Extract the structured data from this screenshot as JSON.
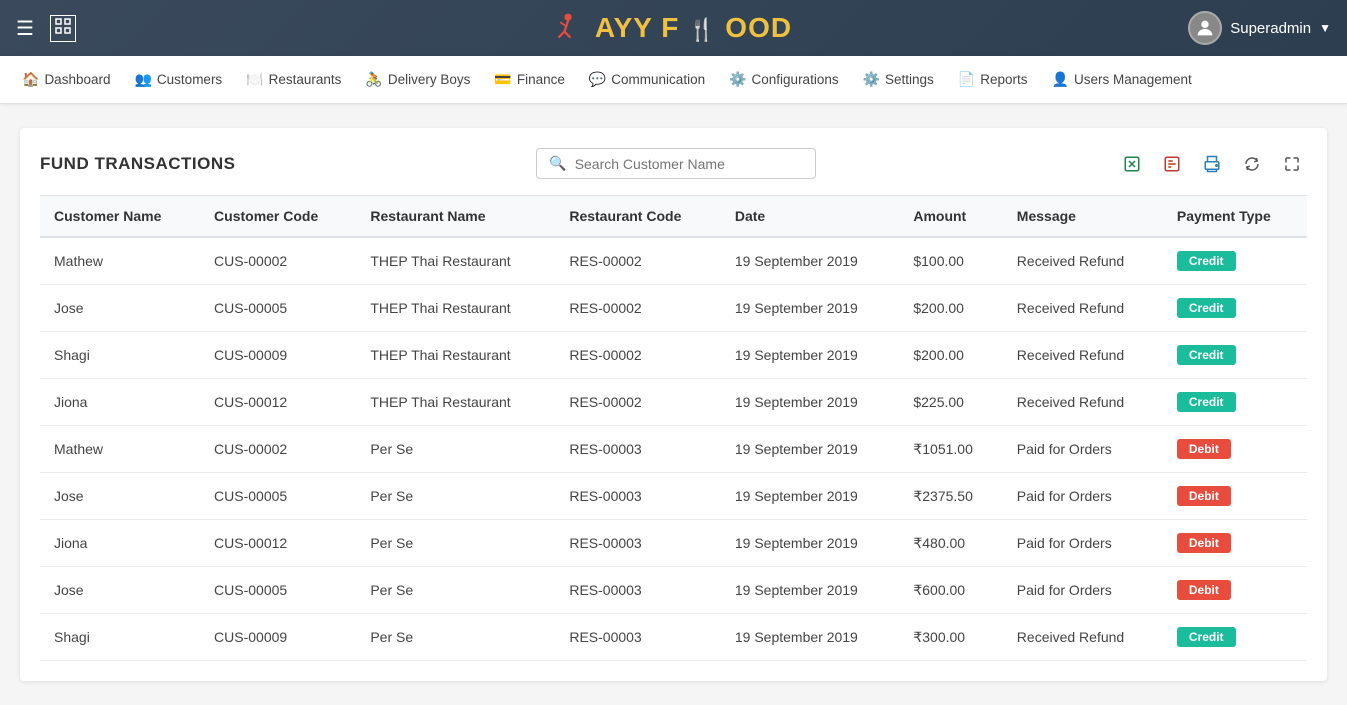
{
  "header": {
    "hamburger_label": "☰",
    "maximize_label": "⛶",
    "logo_part1": "AYY",
    "logo_part2": "F",
    "logo_part3": "OOD",
    "username": "Superadmin",
    "chevron": "▼"
  },
  "navbar": {
    "items": [
      {
        "id": "dashboard",
        "icon": "🏠",
        "label": "Dashboard"
      },
      {
        "id": "customers",
        "icon": "👥",
        "label": "Customers"
      },
      {
        "id": "restaurants",
        "icon": "🍽️",
        "label": "Restaurants"
      },
      {
        "id": "delivery-boys",
        "icon": "🚴",
        "label": "Delivery Boys"
      },
      {
        "id": "finance",
        "icon": "💳",
        "label": "Finance"
      },
      {
        "id": "communication",
        "icon": "💬",
        "label": "Communication"
      },
      {
        "id": "configurations",
        "icon": "⚙️",
        "label": "Configurations"
      },
      {
        "id": "settings",
        "icon": "⚙️",
        "label": "Settings"
      },
      {
        "id": "reports",
        "icon": "📄",
        "label": "Reports"
      },
      {
        "id": "users-management",
        "icon": "👤",
        "label": "Users Management"
      }
    ]
  },
  "page": {
    "title": "FUND TRANSACTIONS",
    "search_placeholder": "Search Customer Name"
  },
  "table": {
    "columns": [
      "Customer Name",
      "Customer Code",
      "Restaurant Name",
      "Restaurant Code",
      "Date",
      "Amount",
      "Message",
      "Payment Type"
    ],
    "rows": [
      {
        "customer_name": "Mathew",
        "customer_code": "CUS-00002",
        "restaurant_name": "THEP Thai Restaurant",
        "restaurant_code": "RES-00002",
        "date": "19 September 2019",
        "amount": "$100.00",
        "message": "Received Refund",
        "payment_type": "Credit",
        "payment_class": "credit"
      },
      {
        "customer_name": "Jose",
        "customer_code": "CUS-00005",
        "restaurant_name": "THEP Thai Restaurant",
        "restaurant_code": "RES-00002",
        "date": "19 September 2019",
        "amount": "$200.00",
        "message": "Received Refund",
        "payment_type": "Credit",
        "payment_class": "credit"
      },
      {
        "customer_name": "Shagi",
        "customer_code": "CUS-00009",
        "restaurant_name": "THEP Thai Restaurant",
        "restaurant_code": "RES-00002",
        "date": "19 September 2019",
        "amount": "$200.00",
        "message": "Received Refund",
        "payment_type": "Credit",
        "payment_class": "credit"
      },
      {
        "customer_name": "Jiona",
        "customer_code": "CUS-00012",
        "restaurant_name": "THEP Thai Restaurant",
        "restaurant_code": "RES-00002",
        "date": "19 September 2019",
        "amount": "$225.00",
        "message": "Received Refund",
        "payment_type": "Credit",
        "payment_class": "credit"
      },
      {
        "customer_name": "Mathew",
        "customer_code": "CUS-00002",
        "restaurant_name": "Per Se",
        "restaurant_code": "RES-00003",
        "date": "19 September 2019",
        "amount": "₹1051.00",
        "message": "Paid for Orders",
        "payment_type": "Debit",
        "payment_class": "debit"
      },
      {
        "customer_name": "Jose",
        "customer_code": "CUS-00005",
        "restaurant_name": "Per Se",
        "restaurant_code": "RES-00003",
        "date": "19 September 2019",
        "amount": "₹2375.50",
        "message": "Paid for Orders",
        "payment_type": "Debit",
        "payment_class": "debit"
      },
      {
        "customer_name": "Jiona",
        "customer_code": "CUS-00012",
        "restaurant_name": "Per Se",
        "restaurant_code": "RES-00003",
        "date": "19 September 2019",
        "amount": "₹480.00",
        "message": "Paid for Orders",
        "payment_type": "Debit",
        "payment_class": "debit"
      },
      {
        "customer_name": "Jose",
        "customer_code": "CUS-00005",
        "restaurant_name": "Per Se",
        "restaurant_code": "RES-00003",
        "date": "19 September 2019",
        "amount": "₹600.00",
        "message": "Paid for Orders",
        "payment_type": "Debit",
        "payment_class": "debit"
      },
      {
        "customer_name": "Shagi",
        "customer_code": "CUS-00009",
        "restaurant_name": "Per Se",
        "restaurant_code": "RES-00003",
        "date": "19 September 2019",
        "amount": "₹300.00",
        "message": "Received Refund",
        "payment_type": "Credit",
        "payment_class": "credit"
      }
    ]
  }
}
